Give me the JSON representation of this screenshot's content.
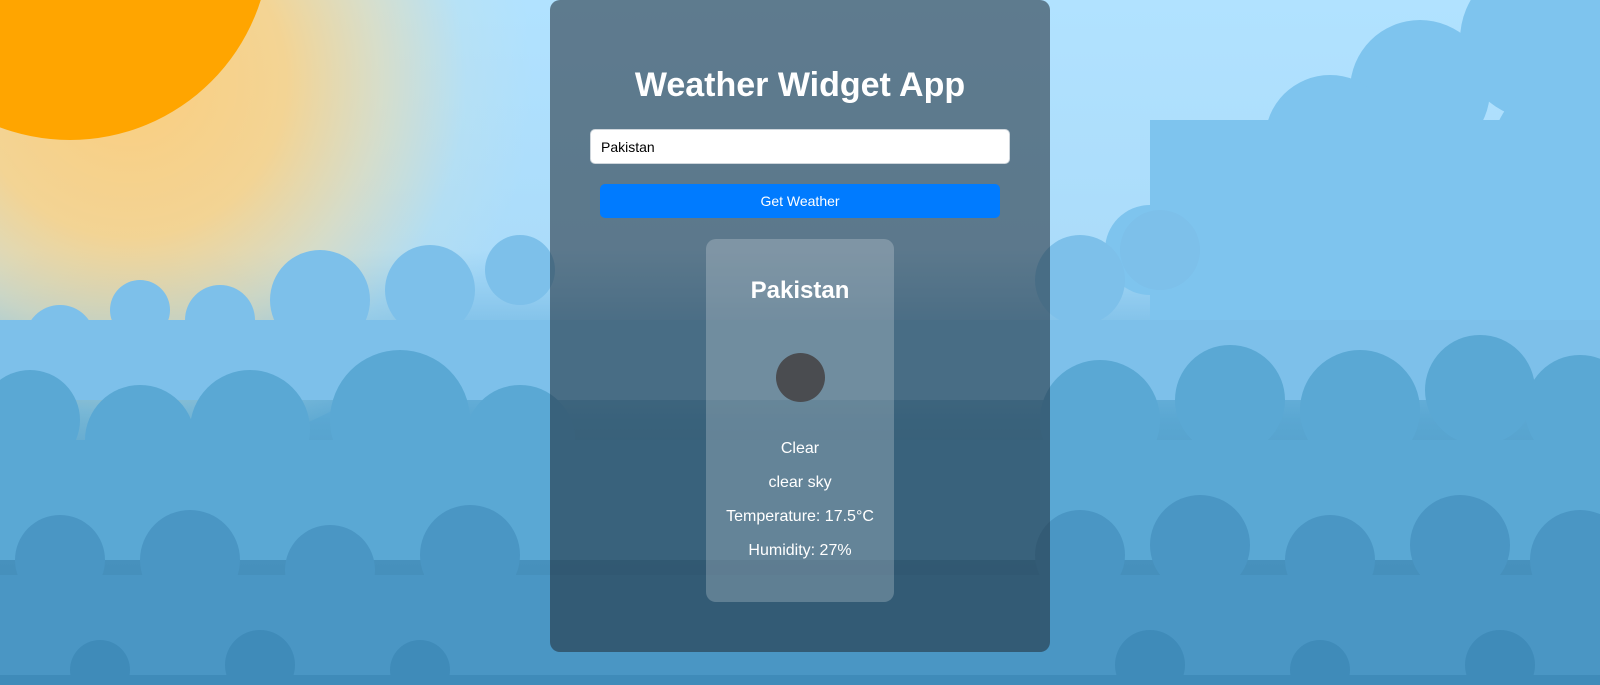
{
  "app": {
    "title": "Weather Widget App"
  },
  "search": {
    "value": "Pakistan",
    "button_label": "Get Weather"
  },
  "weather": {
    "city": "Pakistan",
    "icon": "clear-sky-icon",
    "main": "Clear",
    "description": "clear sky",
    "temperature": "Temperature: 17.5°C",
    "humidity": "Humidity: 27%"
  },
  "colors": {
    "button": "#007bff",
    "sun": "#ffa500",
    "sky": "#b1e2ff"
  }
}
